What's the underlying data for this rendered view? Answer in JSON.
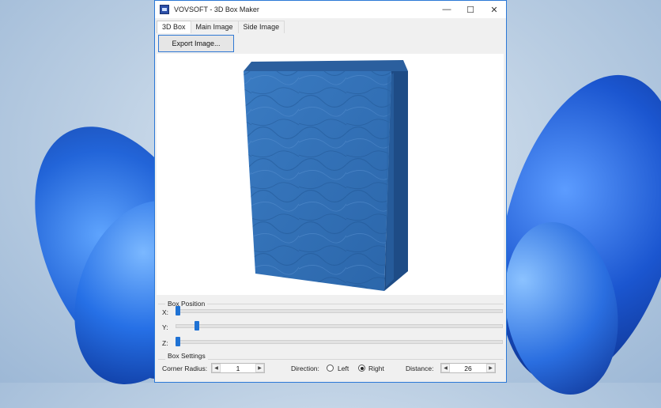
{
  "window": {
    "title": "VOVSOFT - 3D Box Maker",
    "minimize": "—",
    "maximize": "☐",
    "close": "✕"
  },
  "tabs": [
    {
      "label": "3D Box",
      "active": true
    },
    {
      "label": "Main Image",
      "active": false
    },
    {
      "label": "Side Image",
      "active": false
    }
  ],
  "toolbar": {
    "export_label": "Export Image..."
  },
  "box_position": {
    "title": "Box Position",
    "x_label": "X:",
    "y_label": "Y:",
    "z_label": "Z:",
    "x_level": 0.0,
    "y_level": 0.06,
    "z_level": 0.0
  },
  "box_settings": {
    "title": "Box Settings",
    "corner_radius_label": "Corner Radius:",
    "corner_radius_value": "1",
    "direction_label": "Direction:",
    "left_label": "Left",
    "right_label": "Right",
    "direction_selected": "Right",
    "distance_label": "Distance:",
    "distance_value": "26"
  },
  "colors": {
    "accent": "#2b78d6",
    "box_front": "#2f6fb6",
    "box_side": "#1e4f88",
    "box_top": "#2a5fa0"
  }
}
